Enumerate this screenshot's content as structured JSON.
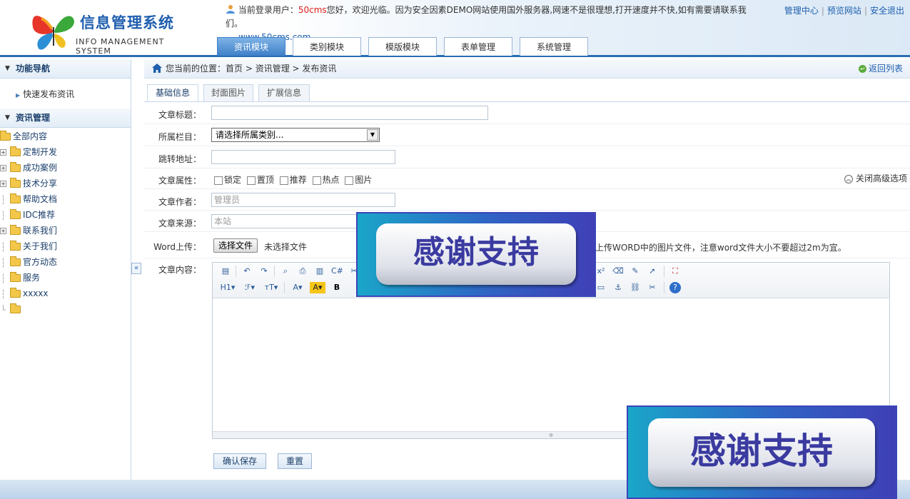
{
  "header": {
    "logo_title": "信息管理系统",
    "logo_sub": "INFO MANAGEMENT SYSTEM",
    "welcome_prefix": "当前登录用户：",
    "welcome_user": "50cms",
    "welcome_msg": "您好，欢迎光临。因为安全因素DEMO网站使用国外服务器,网速不是很理想,打开速度并不快,如有需要请联系我们。",
    "welcome_site": "www.50cms.com",
    "links": [
      "管理中心",
      "预览网站",
      "安全退出"
    ],
    "tabs": [
      "资讯模块",
      "类别模块",
      "模版模块",
      "表单管理",
      "系统管理"
    ]
  },
  "sidebar": {
    "nav_title": "功能导航",
    "quick_link": "快速发布资讯",
    "section_title": "资讯管理",
    "tree_root": "全部内容",
    "tree_items": [
      "定制开发",
      "成功案例",
      "技术分享",
      "帮助文档",
      "IDC推荐",
      "联系我们",
      "关于我们",
      "官方动态",
      "服务",
      "xxxxx",
      ""
    ]
  },
  "breadcrumb": {
    "prefix": "您当前的位置：",
    "path": "首页 > 资讯管理 > 发布资讯",
    "back": "返回列表"
  },
  "subtabs": [
    "基础信息",
    "封面图片",
    "扩展信息"
  ],
  "form": {
    "title_label": "文章标题：",
    "category_label": "所属栏目：",
    "category_value": "请选择所属类别...",
    "redirect_label": "跳转地址：",
    "attr_label": "文章属性：",
    "attrs": [
      "锁定",
      "置顶",
      "推荐",
      "热点",
      "图片"
    ],
    "advanced_toggle": "关闭高级选项",
    "author_label": "文章作者：",
    "author_value": "管理员",
    "source_label": "文章来源：",
    "source_value": "本站",
    "word_label": "Word上传：",
    "file_button": "选择文件",
    "file_status": "未选择文件",
    "word_hint": "上传WORD中的图片文件，注意word文件大小不要超过2m为宜。",
    "content_label": "文章内容：",
    "save_button": "确认保存",
    "reset_button": "重置"
  },
  "overlay": {
    "banner_text": "感谢支持"
  },
  "colors": {
    "brand": "#1f5fae",
    "accent_red": "#e0201a",
    "tab_active": "#3f80c8"
  }
}
